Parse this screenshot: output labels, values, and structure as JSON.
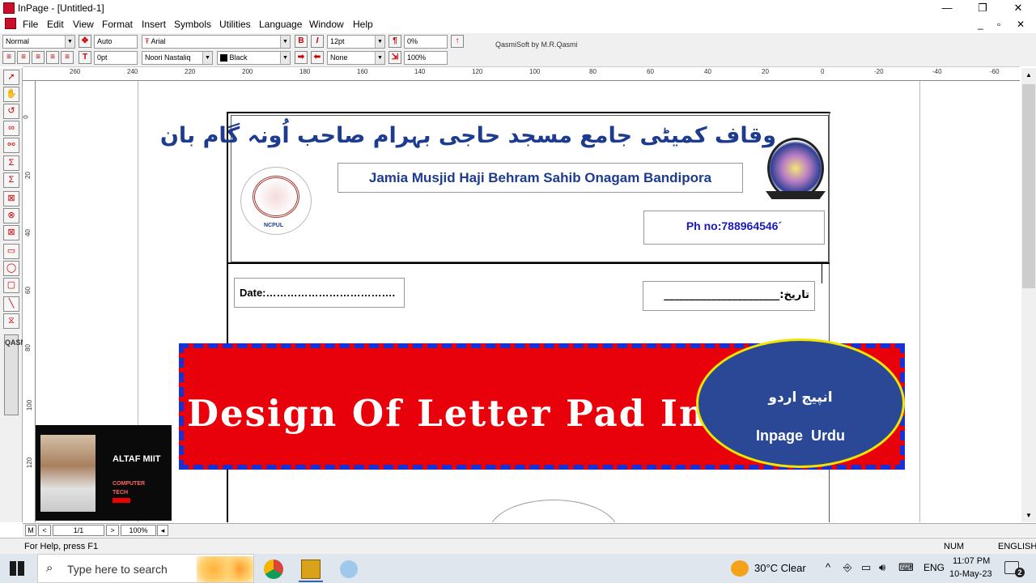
{
  "window": {
    "title": "InPage - [Untitled-1]",
    "minimize": "—",
    "maximize": "❐",
    "close": "✕",
    "doc_min": "_",
    "doc_max": "▫",
    "doc_close": "✕"
  },
  "menu": [
    "File",
    "Edit",
    "View",
    "Format",
    "Insert",
    "Symbols",
    "Utilities",
    "Language",
    "Window",
    "Help"
  ],
  "toolbar1": {
    "style": "Normal",
    "leading": "Auto",
    "font_en": "Arial",
    "size": "12pt",
    "percent": "0%",
    "credit": "QasmiSoft by M.R.Qasmi",
    "bold": "B",
    "italic": "I"
  },
  "toolbar2": {
    "tracking": "0pt",
    "font_ur": "Noori Nastaliq",
    "color": "Black",
    "shading": "None",
    "scale": "100%"
  },
  "ruler_h": [
    "260",
    "240",
    "220",
    "200",
    "180",
    "160",
    "140",
    "120",
    "100",
    "80",
    "60",
    "40",
    "20",
    "0",
    "-20",
    "-40",
    "-60"
  ],
  "ruler_v": [
    "0",
    "20",
    "40",
    "60",
    "80",
    "100",
    "120"
  ],
  "toolbox": {
    "vertical_text": "QASMISOFT"
  },
  "letterhead": {
    "urdu_title": "وقاف کمیٹی جامع مسجد حاجی بہرام صاحب اُونہ گام بان",
    "english_title": "Jamia Musjid Haji Behram Sahib Onagam Bandipora",
    "phone": "Ph  no:788964546´",
    "date_label": "Date:……………………………….",
    "urdu_date": "تاریخ:______________________",
    "left_logo_caption": "NCPUL"
  },
  "banner": {
    "text": "Design Of Letter Pad In",
    "urdu": "انپیج اردو",
    "english": "Inpage  Urdu"
  },
  "webcam": {
    "name": "ALTAF MIIT",
    "subtitle1": "COMPUTER",
    "subtitle2": "TECH"
  },
  "hscroll": {
    "m": "M",
    "page": "1/1",
    "zoom": "100%"
  },
  "status": {
    "help": "For Help, press F1",
    "num": "NUM",
    "lang": "ENGLISH"
  },
  "taskbar": {
    "search_placeholder": "Type here to search",
    "weather": "30°C  Clear",
    "lang": "ENG",
    "time": "11:07 PM",
    "date": "10-May-23",
    "notif": "2"
  },
  "colors": {
    "banner_red": "#e8000a",
    "banner_blue": "#1632d6",
    "ellipse": "#2a4896",
    "ellipse_border": "#f2e600",
    "title_blue": "#1d3c8f"
  }
}
